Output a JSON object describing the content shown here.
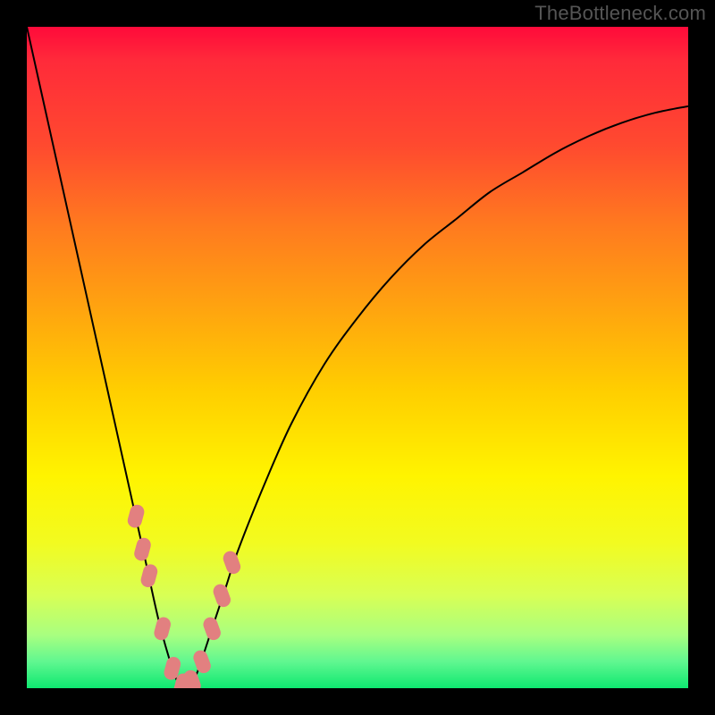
{
  "watermark": "TheBottleneck.com",
  "colors": {
    "background": "#000000",
    "curve": "#000000",
    "marker": "#e28080",
    "gradient_top": "#ff0a3a",
    "gradient_bottom": "#0ee870"
  },
  "chart_data": {
    "type": "line",
    "title": "",
    "xlabel": "",
    "ylabel": "",
    "xlim": [
      0,
      100
    ],
    "ylim": [
      0,
      100
    ],
    "x": [
      0,
      2,
      4,
      6,
      8,
      10,
      12,
      14,
      16,
      18,
      20,
      22,
      23,
      24,
      25,
      26,
      28,
      30,
      32,
      36,
      40,
      45,
      50,
      55,
      60,
      65,
      70,
      75,
      80,
      85,
      90,
      95,
      100
    ],
    "y": [
      100,
      91,
      82,
      73,
      64,
      55,
      46,
      37,
      28,
      19,
      10,
      3,
      0.7,
      0,
      0.7,
      3,
      9,
      15,
      21,
      31,
      40,
      49,
      56,
      62,
      67,
      71,
      75,
      78,
      81,
      83.5,
      85.5,
      87,
      88
    ],
    "series": [
      {
        "name": "markers",
        "x": [
          16.5,
          17.5,
          18.5,
          20.5,
          22.0,
          23.5,
          25.0,
          26.5,
          28.0,
          29.5,
          31.0
        ],
        "y": [
          26,
          21,
          17,
          9,
          3,
          0.5,
          1,
          4,
          9,
          14,
          19
        ]
      }
    ]
  }
}
